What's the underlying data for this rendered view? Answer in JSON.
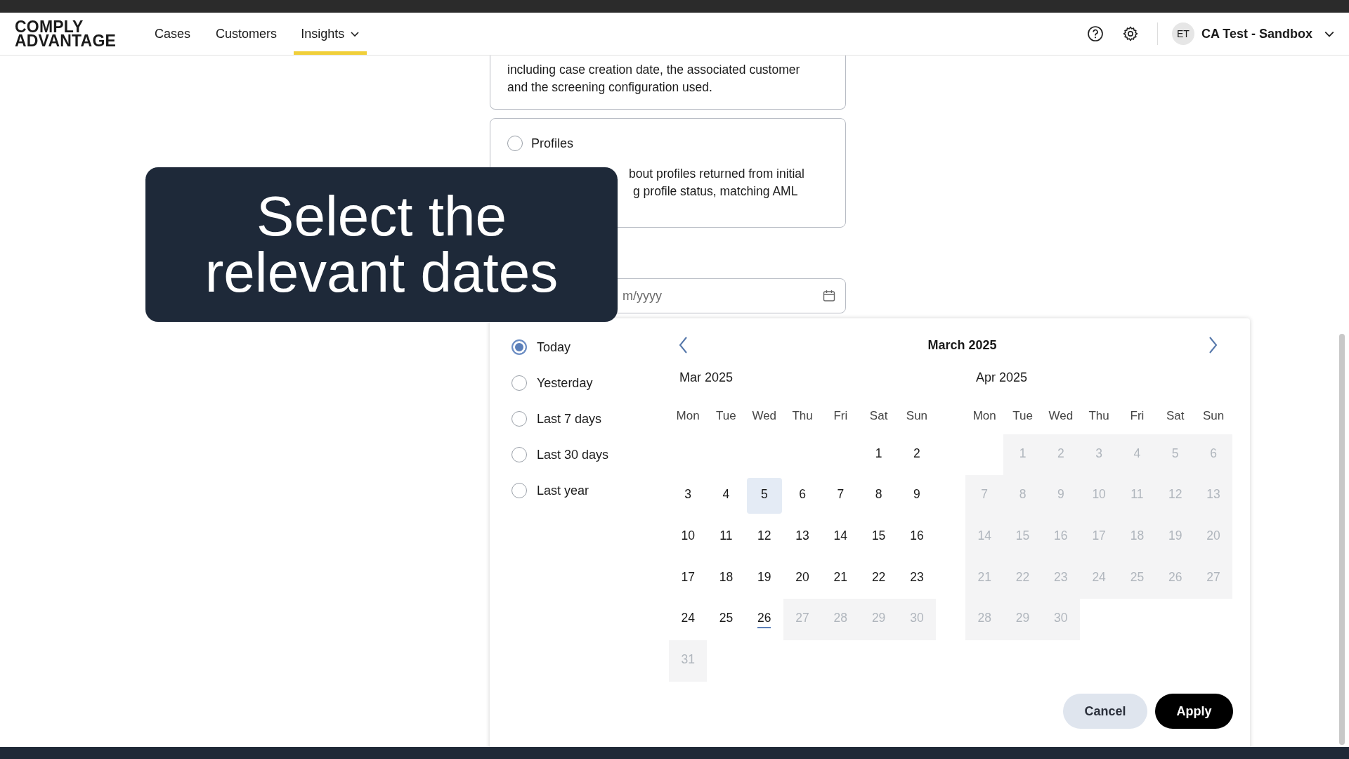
{
  "header": {
    "logo": [
      "COMPLY",
      "ADVANTAGE"
    ],
    "nav": [
      {
        "label": "Cases",
        "selected": false,
        "dropdown": false
      },
      {
        "label": "Customers",
        "selected": false,
        "dropdown": false
      },
      {
        "label": "Insights",
        "selected": true,
        "dropdown": true
      }
    ],
    "account": {
      "initials": "ET",
      "name": "CA Test - Sandbox"
    }
  },
  "report_types": [
    {
      "description": [
        "including case creation date, the associated customer",
        "and the screening configuration used."
      ]
    },
    {
      "label": "Profiles",
      "selected": false,
      "description": [
        "bout profiles returned from initial",
        "g profile status, matching AML"
      ]
    }
  ],
  "date_field": {
    "placeholder": "m/yyyy"
  },
  "caption": [
    "Select the",
    "relevant dates"
  ],
  "date_picker": {
    "presets": [
      {
        "label": "Today",
        "selected": true
      },
      {
        "label": "Yesterday",
        "selected": false
      },
      {
        "label": "Last 7 days",
        "selected": false
      },
      {
        "label": "Last 30 days",
        "selected": false
      },
      {
        "label": "Last year",
        "selected": false
      }
    ],
    "title": "March 2025",
    "months": [
      {
        "label": "Mar 2025",
        "weekdays": [
          "Mon",
          "Tue",
          "Wed",
          "Thu",
          "Fri",
          "Sat",
          "Sun"
        ],
        "weeks": [
          [
            {
              "day": "1",
              "disabled": false,
              "today": false,
              "highlighted": false
            },
            {
              "day": "2",
              "disabled": false,
              "today": false,
              "highlighted": false
            }
          ],
          [
            {
              "day": "3",
              "disabled": false,
              "today": false,
              "highlighted": false
            },
            {
              "day": "4",
              "disabled": false,
              "today": false,
              "highlighted": false
            },
            {
              "day": "5",
              "disabled": false,
              "today": false,
              "highlighted": true
            },
            {
              "day": "6",
              "disabled": false,
              "today": false,
              "highlighted": false
            },
            {
              "day": "7",
              "disabled": false,
              "today": false,
              "highlighted": false
            },
            {
              "day": "8",
              "disabled": false,
              "today": false,
              "highlighted": false
            },
            {
              "day": "9",
              "disabled": false,
              "today": false,
              "highlighted": false
            }
          ],
          [
            {
              "day": "10",
              "disabled": false,
              "today": false,
              "highlighted": false
            },
            {
              "day": "11",
              "disabled": false,
              "today": false,
              "highlighted": false
            },
            {
              "day": "12",
              "disabled": false,
              "today": false,
              "highlighted": false
            },
            {
              "day": "13",
              "disabled": false,
              "today": false,
              "highlighted": false
            },
            {
              "day": "14",
              "disabled": false,
              "today": false,
              "highlighted": false
            },
            {
              "day": "15",
              "disabled": false,
              "today": false,
              "highlighted": false
            },
            {
              "day": "16",
              "disabled": false,
              "today": false,
              "highlighted": false
            }
          ],
          [
            {
              "day": "17",
              "disabled": false,
              "today": false,
              "highlighted": false
            },
            {
              "day": "18",
              "disabled": false,
              "today": false,
              "highlighted": false
            },
            {
              "day": "19",
              "disabled": false,
              "today": false,
              "highlighted": false
            },
            {
              "day": "20",
              "disabled": false,
              "today": false,
              "highlighted": false
            },
            {
              "day": "21",
              "disabled": false,
              "today": false,
              "highlighted": false
            },
            {
              "day": "22",
              "disabled": false,
              "today": false,
              "highlighted": false
            },
            {
              "day": "23",
              "disabled": false,
              "today": false,
              "highlighted": false
            }
          ],
          [
            {
              "day": "24",
              "disabled": false,
              "today": false,
              "highlighted": false
            },
            {
              "day": "25",
              "disabled": false,
              "today": false,
              "highlighted": false
            },
            {
              "day": "26",
              "disabled": false,
              "today": true,
              "highlighted": false
            },
            {
              "day": "27",
              "disabled": true,
              "today": false,
              "highlighted": false
            },
            {
              "day": "28",
              "disabled": true,
              "today": false,
              "highlighted": false
            },
            {
              "day": "29",
              "disabled": true,
              "today": false,
              "highlighted": false
            },
            {
              "day": "30",
              "disabled": true,
              "today": false,
              "highlighted": false
            }
          ],
          [
            {
              "day": "31",
              "disabled": true,
              "today": false,
              "highlighted": false
            }
          ]
        ]
      },
      {
        "label": "Apr 2025",
        "weekdays": [
          "Mon",
          "Tue",
          "Wed",
          "Thu",
          "Fri",
          "Sat",
          "Sun"
        ],
        "weeks": [
          [
            {
              "day": "1",
              "disabled": true,
              "today": false,
              "highlighted": false
            },
            {
              "day": "2",
              "disabled": true,
              "today": false,
              "highlighted": false
            },
            {
              "day": "3",
              "disabled": true,
              "today": false,
              "highlighted": false
            },
            {
              "day": "4",
              "disabled": true,
              "today": false,
              "highlighted": false
            },
            {
              "day": "5",
              "disabled": true,
              "today": false,
              "highlighted": false
            },
            {
              "day": "6",
              "disabled": true,
              "today": false,
              "highlighted": false
            }
          ],
          [
            {
              "day": "7",
              "disabled": true,
              "today": false,
              "highlighted": false
            },
            {
              "day": "8",
              "disabled": true,
              "today": false,
              "highlighted": false
            },
            {
              "day": "9",
              "disabled": true,
              "today": false,
              "highlighted": false
            },
            {
              "day": "10",
              "disabled": true,
              "today": false,
              "highlighted": false
            },
            {
              "day": "11",
              "disabled": true,
              "today": false,
              "highlighted": false
            },
            {
              "day": "12",
              "disabled": true,
              "today": false,
              "highlighted": false
            },
            {
              "day": "13",
              "disabled": true,
              "today": false,
              "highlighted": false
            }
          ],
          [
            {
              "day": "14",
              "disabled": true,
              "today": false,
              "highlighted": false
            },
            {
              "day": "15",
              "disabled": true,
              "today": false,
              "highlighted": false
            },
            {
              "day": "16",
              "disabled": true,
              "today": false,
              "highlighted": false
            },
            {
              "day": "17",
              "disabled": true,
              "today": false,
              "highlighted": false
            },
            {
              "day": "18",
              "disabled": true,
              "today": false,
              "highlighted": false
            },
            {
              "day": "19",
              "disabled": true,
              "today": false,
              "highlighted": false
            },
            {
              "day": "20",
              "disabled": true,
              "today": false,
              "highlighted": false
            }
          ],
          [
            {
              "day": "21",
              "disabled": true,
              "today": false,
              "highlighted": false
            },
            {
              "day": "22",
              "disabled": true,
              "today": false,
              "highlighted": false
            },
            {
              "day": "23",
              "disabled": true,
              "today": false,
              "highlighted": false
            },
            {
              "day": "24",
              "disabled": true,
              "today": false,
              "highlighted": false
            },
            {
              "day": "25",
              "disabled": true,
              "today": false,
              "highlighted": false
            },
            {
              "day": "26",
              "disabled": true,
              "today": false,
              "highlighted": false
            },
            {
              "day": "27",
              "disabled": true,
              "today": false,
              "highlighted": false
            }
          ],
          [
            {
              "day": "28",
              "disabled": true,
              "today": false,
              "highlighted": false
            },
            {
              "day": "29",
              "disabled": true,
              "today": false,
              "highlighted": false
            },
            {
              "day": "30",
              "disabled": true,
              "today": false,
              "highlighted": false
            }
          ]
        ]
      }
    ],
    "buttons": [
      {
        "label": "Cancel",
        "kind": "secondary"
      },
      {
        "label": "Apply",
        "kind": "primary"
      }
    ]
  }
}
